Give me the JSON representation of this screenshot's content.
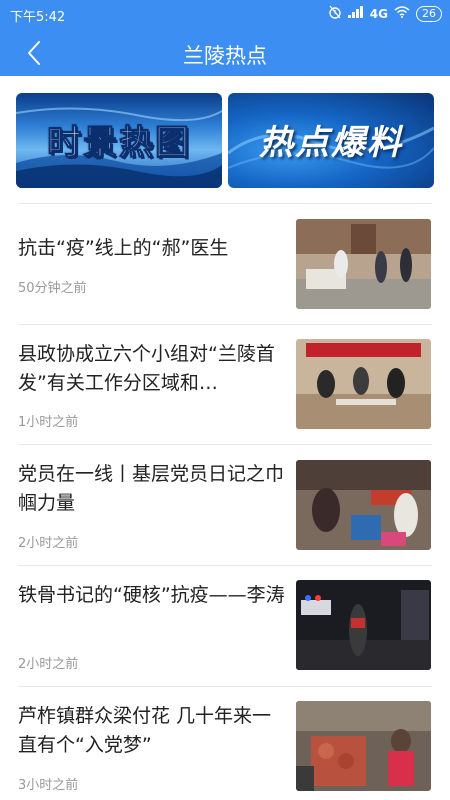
{
  "status_bar": {
    "time": "下午5:42",
    "network": "4G",
    "battery": "26"
  },
  "header": {
    "title": "兰陵热点"
  },
  "banners": [
    {
      "label": "时景热图"
    },
    {
      "label": "热点爆料"
    }
  ],
  "news": [
    {
      "title": "抗击“疫”线上的“郝”医生",
      "time": "50分钟之前"
    },
    {
      "title": "县政协成立六个小组对“兰陵首发”有关工作分区域和…",
      "time": "1小时之前"
    },
    {
      "title": "党员在一线丨基层党员日记之巾帼力量",
      "time": "2小时之前"
    },
    {
      "title": "铁骨书记的“硬核”抗疫——李涛",
      "time": "2小时之前"
    },
    {
      "title": "芦柞镇群众梁付花 几十年来一直有个“入党梦”",
      "time": "3小时之前"
    }
  ],
  "colors": {
    "header_bg": "#3c8ef3",
    "title_text": "#222222",
    "time_text": "#999999"
  }
}
